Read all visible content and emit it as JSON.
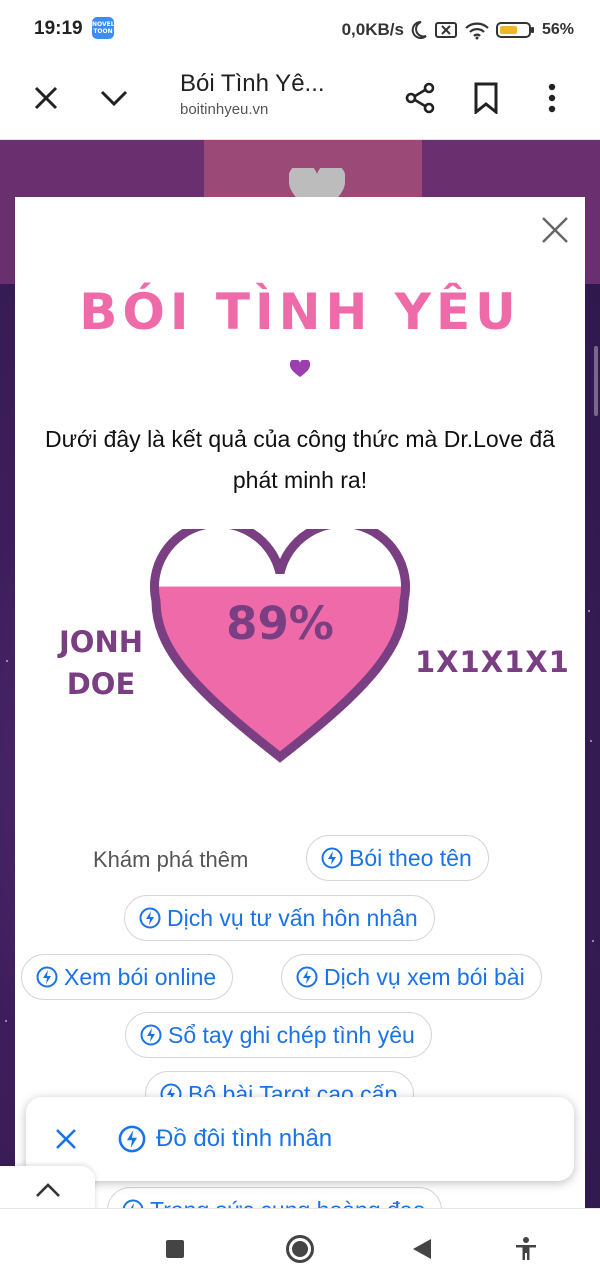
{
  "status_bar": {
    "time": "19:19",
    "app_badge": "NOVEL TOON",
    "net_speed": "0,0KB/s",
    "battery": "56%"
  },
  "toolbar": {
    "title": "Bói Tình Yê...",
    "url": "boitinhyeu.vn"
  },
  "modal": {
    "title": "BÓI TÌNH YÊU",
    "description": "Dưới đây là kết quả của công thức mà Dr.Love đã phát minh ra!",
    "name_left": "JONH DOE",
    "name_right": "1X1X1X1",
    "result_percent": "89%",
    "result_fill": 0.89
  },
  "explore": {
    "label": "Khám phá thêm",
    "chips": [
      "Bói theo tên",
      "Dịch vụ tư vấn hôn nhân",
      "Xem bói online",
      "Dịch vụ xem bói bài",
      "Sổ tay ghi chép tình yêu",
      "Bộ bài Tarot cao cấp",
      "Trang sức cung hoàng đạo"
    ]
  },
  "float_bar": {
    "chip": "Đồ đôi tình nhân"
  },
  "colors": {
    "title_pink": "#ef6aa8",
    "heart_fill": "#ef6aa8",
    "heart_border": "#7a3e82",
    "link_blue": "#1a73e8"
  }
}
